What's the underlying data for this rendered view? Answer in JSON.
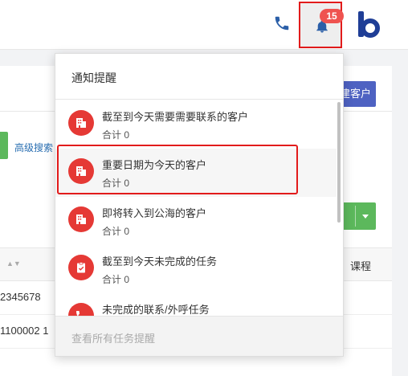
{
  "header": {
    "notification_count": "15",
    "icons": [
      "phone-icon",
      "bell-icon",
      "brand-logo"
    ]
  },
  "page": {
    "add_button_label": "建客户",
    "advanced_search_label": "高级搜索",
    "table": {
      "course_header": "课程",
      "rows": [
        "2345678",
        "1100002 1"
      ]
    }
  },
  "notifications": {
    "title": "通知提醒",
    "items": [
      {
        "title": "截至到今天需要需要联系的客户",
        "count": "合计 0",
        "icon": "building-icon"
      },
      {
        "title": "重要日期为今天的客户",
        "count": "合计 0",
        "icon": "building-icon"
      },
      {
        "title": "即将转入到公海的客户",
        "count": "合计 0",
        "icon": "building-icon"
      },
      {
        "title": "截至到今天未完成的任务",
        "count": "合计 0",
        "icon": "clipboard-icon"
      },
      {
        "title": "未完成的联系/外呼任务",
        "count": "",
        "icon": "phone-icon"
      }
    ],
    "footer_label": "查看所有任务提醒"
  },
  "colors": {
    "accent_red": "#e53935",
    "badge_red": "#ef5350",
    "primary_blue": "#4e62c2",
    "success_green": "#5cb85c",
    "annotation_red": "#e21b1b"
  }
}
